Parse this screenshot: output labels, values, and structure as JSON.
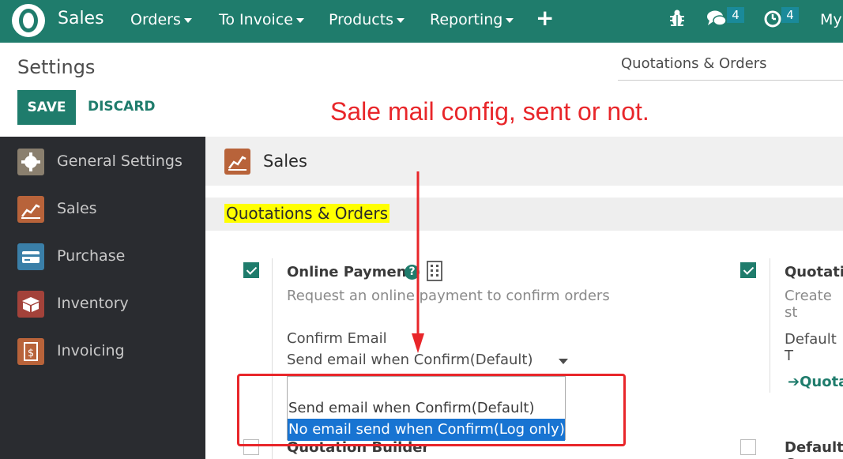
{
  "navbar": {
    "app_name": "Sales",
    "menus": [
      "Orders",
      "To Invoice",
      "Products",
      "Reporting"
    ],
    "plus_label": "+",
    "chat_badge": "4",
    "activity_badge": "4",
    "user_label": "My"
  },
  "control_panel": {
    "title": "Settings",
    "save_label": "SAVE",
    "discard_label": "DISCARD",
    "search_value": "Quotations & Orders"
  },
  "annotation": {
    "text": "Sale mail config, sent or not."
  },
  "sidebar": {
    "items": [
      {
        "label": "General Settings",
        "icon": "gear-icon",
        "color": "#8a7f6e"
      },
      {
        "label": "Sales",
        "icon": "chart-icon",
        "color": "#b8633a"
      },
      {
        "label": "Purchase",
        "icon": "credit-card-icon",
        "color": "#3a7fa8"
      },
      {
        "label": "Inventory",
        "icon": "box-icon",
        "color": "#a3423a"
      },
      {
        "label": "Invoicing",
        "icon": "dollar-document-icon",
        "color": "#b8633a"
      }
    ]
  },
  "main": {
    "app_title": "Sales",
    "section_title": "Quotations & Orders",
    "online_payment": {
      "title": "Online Payment",
      "help": "?",
      "description": "Request an online payment to confirm orders",
      "confirm_email_label": "Confirm Email",
      "selected_value": "Send email when Confirm(Default)",
      "options": [
        "",
        "Send email when Confirm(Default)",
        "No email send when Confirm(Log only)"
      ],
      "highlighted_option": 2
    },
    "quotation_templates": {
      "title": "Quotatio",
      "description": "Create st",
      "default_label": "Default T",
      "link_label": "Quota"
    },
    "quotation_builder": {
      "title": "Quotation Builder"
    },
    "default_other": {
      "title": "Default C"
    }
  },
  "colors": {
    "brand": "#1f7c6c",
    "annotation_red": "#e8262a",
    "highlight_yellow": "#ffff00",
    "selection_blue": "#1874d2",
    "sidebar_bg": "#2a2c30"
  }
}
